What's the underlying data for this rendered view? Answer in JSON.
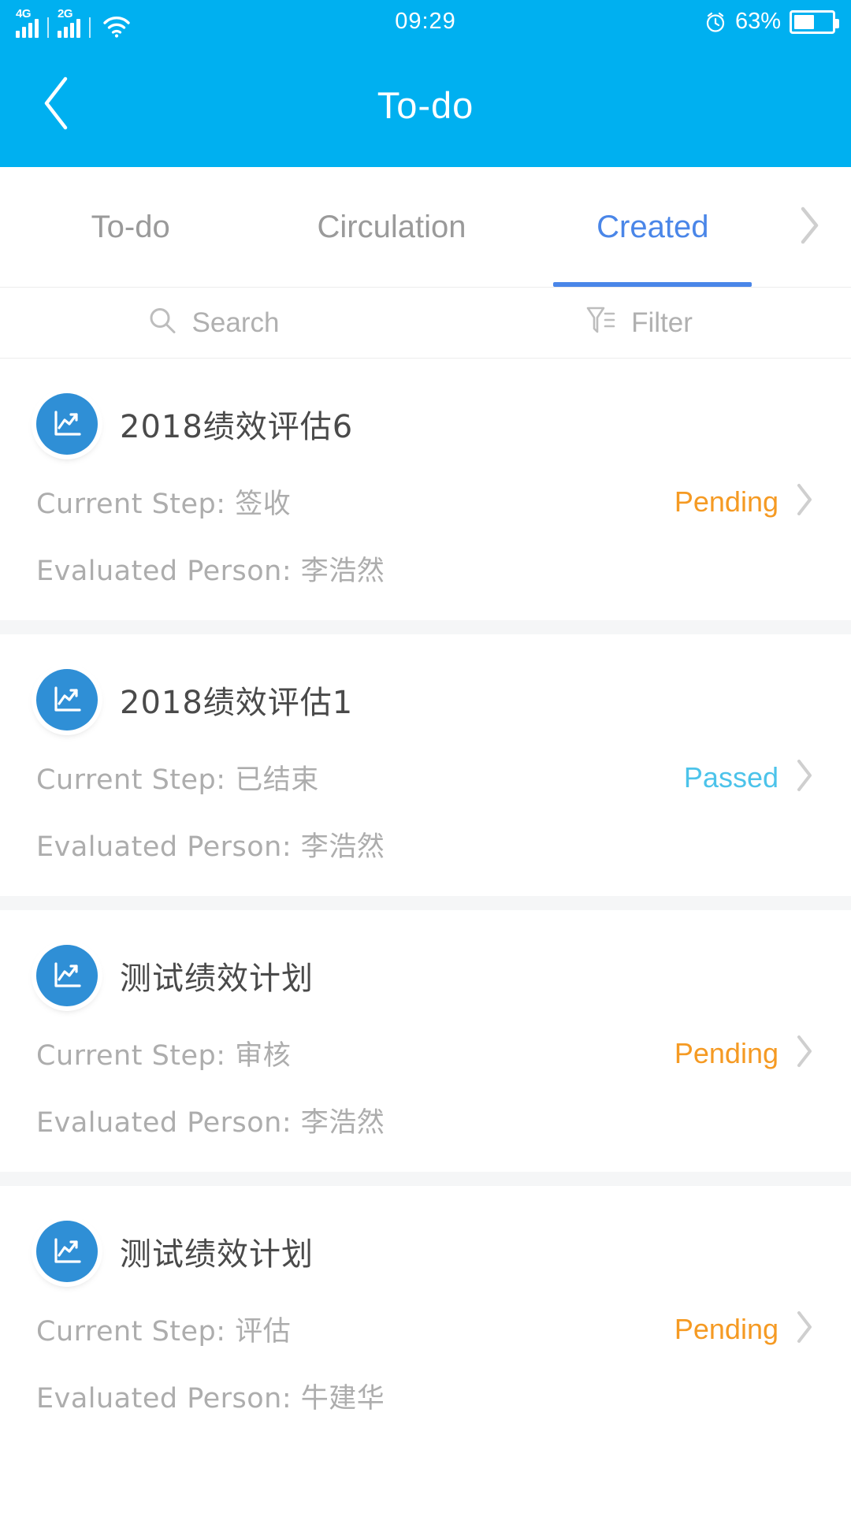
{
  "statusbar": {
    "signal_1_label": "4G",
    "signal_2_label": "2G",
    "wifi_icon": "wifi-icon",
    "time": "09:29",
    "alarm_icon": "alarm-clock-icon",
    "battery_percent": "63%",
    "battery_level": 55
  },
  "header": {
    "back_icon": "back-chevron-icon",
    "title": "To-do"
  },
  "tabs": {
    "items": [
      {
        "label": "To-do",
        "active": false
      },
      {
        "label": "Circulation",
        "active": false
      },
      {
        "label": "Created",
        "active": true
      }
    ],
    "more_icon": "chevron-right-icon",
    "active_color": "#4a86e8"
  },
  "toolbar": {
    "search_icon": "search-icon",
    "search_label": "Search",
    "filter_icon": "filter-icon",
    "filter_label": "Filter"
  },
  "labels": {
    "current_step": "Current Step:",
    "evaluated_person": "Evaluated Person:"
  },
  "colors": {
    "brand": "#00b0f0",
    "pending": "#f59a23",
    "passed": "#4cc3ea",
    "icon_circle": "#2f8fd6"
  },
  "list": {
    "items": [
      {
        "icon": "chart-trend-icon",
        "title": "2018绩效评估6",
        "current_step": "签收",
        "evaluated_person": "李浩然",
        "status": "Pending",
        "status_kind": "pending",
        "chevron_icon": "chevron-right-icon"
      },
      {
        "icon": "chart-trend-icon",
        "title": "2018绩效评估1",
        "current_step": "已结束",
        "evaluated_person": "李浩然",
        "status": "Passed",
        "status_kind": "passed",
        "chevron_icon": "chevron-right-icon"
      },
      {
        "icon": "chart-trend-icon",
        "title": "测试绩效计划",
        "current_step": "审核",
        "evaluated_person": "李浩然",
        "status": "Pending",
        "status_kind": "pending",
        "chevron_icon": "chevron-right-icon"
      },
      {
        "icon": "chart-trend-icon",
        "title": "测试绩效计划",
        "current_step": "评估",
        "evaluated_person": "牛建华",
        "status": "Pending",
        "status_kind": "pending",
        "chevron_icon": "chevron-right-icon"
      }
    ]
  }
}
